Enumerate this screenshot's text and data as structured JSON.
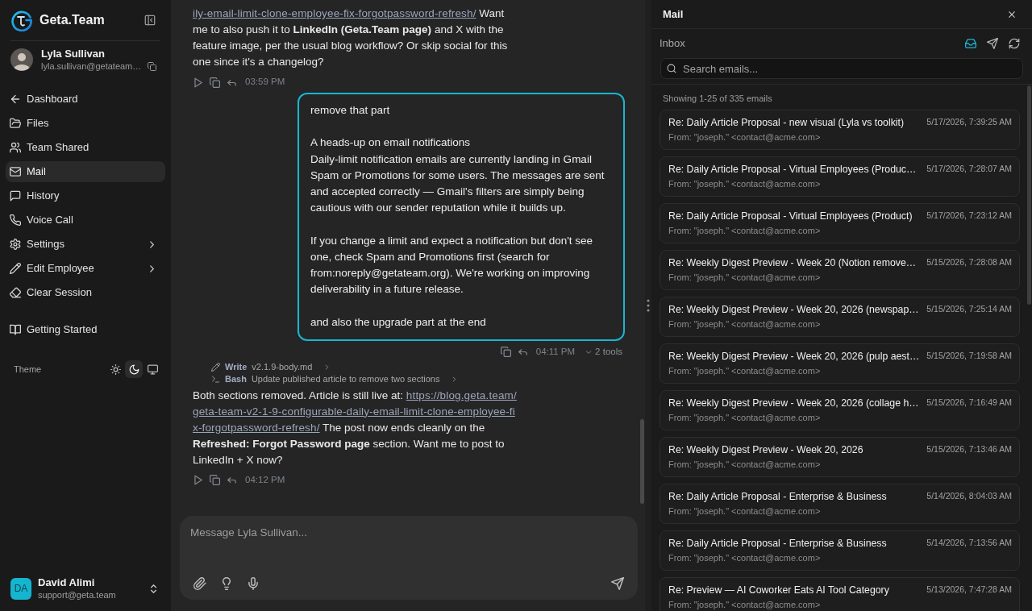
{
  "sidebar": {
    "brand": "Geta.Team",
    "profile": {
      "name": "Lyla Sullivan",
      "email": "lyla.sullivan@getateam…"
    },
    "nav": [
      {
        "label": "Dashboard",
        "selected": false,
        "submenu": false
      },
      {
        "label": "Files",
        "selected": false,
        "submenu": false
      },
      {
        "label": "Team Shared",
        "selected": false,
        "submenu": false
      },
      {
        "label": "Mail",
        "selected": true,
        "submenu": false
      },
      {
        "label": "History",
        "selected": false,
        "submenu": false
      },
      {
        "label": "Voice Call",
        "selected": false,
        "submenu": false
      },
      {
        "label": "Settings",
        "selected": false,
        "submenu": true
      },
      {
        "label": "Edit Employee",
        "selected": false,
        "submenu": true
      },
      {
        "label": "Clear Session",
        "selected": false,
        "submenu": false
      }
    ],
    "help_nav": [
      {
        "label": "Getting Started",
        "selected": false
      }
    ],
    "theme": {
      "label": "Theme",
      "options": [
        {
          "selected": false
        },
        {
          "selected": true
        },
        {
          "selected": false
        }
      ]
    },
    "account": {
      "initials": "DA",
      "name": "David Alimi",
      "email": "support@geta.team"
    }
  },
  "chat": {
    "messages": [
      {
        "kind": "assistant",
        "parts": [
          {
            "kind": "link",
            "text": "ily-email-limit-clone-employee-fix-forgotpassword-refresh/"
          },
          {
            "kind": "text",
            "text": " Want me to also push it to **LinkedIn (Geta.Team page)** and X with the feature image, per the usual blog workflow? Or skip social for this one since it's a changelog?"
          }
        ],
        "time": "03:59 PM"
      },
      {
        "kind": "user",
        "text": "remove that part\n\nA heads-up on email notifications\nDaily-limit notification emails are currently landing in Gmail Spam or Promotions for some users. The messages are sent and accepted correctly — Gmail's filters are simply being cautious with our sender reputation while it builds up.\n\nIf you change a limit and expect a notification but don't see one, check Spam and Promotions first (search for from:noreply@getateam.org). We're working on improving deliverability in a future release.\n\nand also the upgrade part at the end",
        "time": "04:11 PM",
        "tools_label": "2 tools"
      },
      {
        "kind": "assistant",
        "tool_calls": [
          {
            "kind": "write",
            "name": "Write",
            "detail": "v2.1.9-body.md"
          },
          {
            "kind": "bash",
            "name": "Bash",
            "detail": "Update published article to remove two sections"
          }
        ],
        "parts": [
          {
            "kind": "text",
            "text": "Both sections removed. Article is still live at: "
          },
          {
            "kind": "link",
            "text": "https://blog.geta.team/"
          },
          {
            "kind": "link",
            "text": "geta-team-v2-1-9-configurable-daily-email-limit-clone-employee-fi"
          },
          {
            "kind": "link",
            "text": "x-forgotpassword-refresh/"
          },
          {
            "kind": "text",
            "text": " The post now ends cleanly on the **Refreshed: Forgot Password page** section. Want me to post to LinkedIn + X now?"
          }
        ],
        "time": "04:12 PM"
      }
    ],
    "composer": {
      "placeholder": "Message Lyla Sullivan..."
    }
  },
  "mail": {
    "title": "Mail",
    "folder": "Inbox",
    "views": [
      {
        "selected": true
      },
      {
        "selected": false
      }
    ],
    "search": {
      "placeholder": "Search emails..."
    },
    "summary": "Showing 1-25 of 335 emails",
    "emails": [
      {
        "subject": "Re: Daily Article Proposal - new visual (Lyla vs toolkit)",
        "date": "5/17/2026, 7:39:25 AM",
        "from": "From: \"joseph.\" <contact@acme.com>"
      },
      {
        "subject": "Re: Daily Article Proposal - Virtual Employees (Produc…",
        "date": "5/17/2026, 7:28:07 AM",
        "from": "From: \"joseph.\" <contact@acme.com>"
      },
      {
        "subject": "Re: Daily Article Proposal - Virtual Employees (Product)",
        "date": "5/17/2026, 7:23:12 AM",
        "from": "From: \"joseph.\" <contact@acme.com>"
      },
      {
        "subject": "Re: Weekly Digest Preview - Week 20 (Notion remove…",
        "date": "5/15/2026, 7:28:08 AM",
        "from": "From: \"joseph.\" <contact@acme.com>"
      },
      {
        "subject": "Re: Weekly Digest Preview - Week 20, 2026 (newspap…",
        "date": "5/15/2026, 7:25:14 AM",
        "from": "From: \"joseph.\" <contact@acme.com>"
      },
      {
        "subject": "Re: Weekly Digest Preview - Week 20, 2026 (pulp aest…",
        "date": "5/15/2026, 7:19:58 AM",
        "from": "From: \"joseph.\" <contact@acme.com>"
      },
      {
        "subject": "Re: Weekly Digest Preview - Week 20, 2026 (collage h…",
        "date": "5/15/2026, 7:16:49 AM",
        "from": "From: \"joseph.\" <contact@acme.com>"
      },
      {
        "subject": "Re: Weekly Digest Preview - Week 20, 2026",
        "date": "5/15/2026, 7:13:46 AM",
        "from": "From: \"joseph.\" <contact@acme.com>"
      },
      {
        "subject": "Re: Daily Article Proposal - Enterprise & Business",
        "date": "5/14/2026, 8:04:03 AM",
        "from": "From: \"joseph.\" <contact@acme.com>"
      },
      {
        "subject": "Re: Daily Article Proposal - Enterprise & Business",
        "date": "5/14/2026, 7:13:56 AM",
        "from": "From: \"joseph.\" <contact@acme.com>"
      },
      {
        "subject": "Re: Preview — AI Coworker Eats AI Tool Category",
        "date": "5/13/2026, 7:47:28 AM",
        "from": "From: \"joseph.\" <contact@acme.com>"
      }
    ]
  }
}
